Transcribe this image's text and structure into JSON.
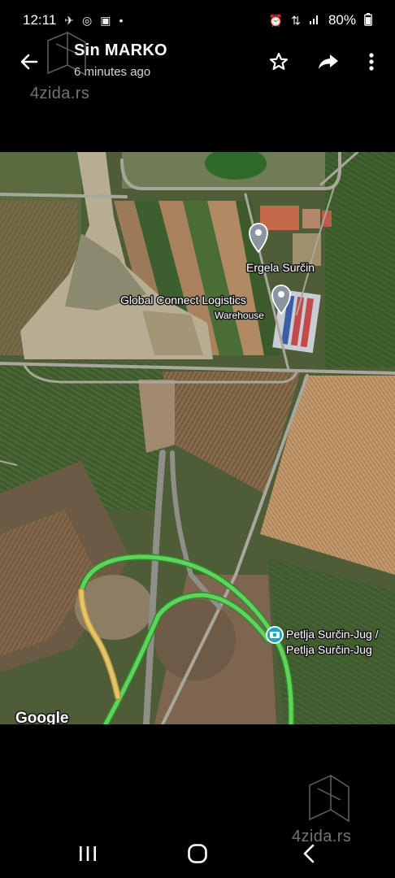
{
  "status_bar": {
    "time": "12:11",
    "battery": "80%",
    "left_icons": [
      "signal-app-icon",
      "whatsapp-icon",
      "gallery-icon",
      "dot-icon"
    ],
    "right_icons": [
      "alarm-icon",
      "data-icon",
      "cell-signal-icon",
      "battery-icon"
    ]
  },
  "header": {
    "sender": "Sin MARKO",
    "time_ago": "6 minutes ago",
    "actions": [
      "back-arrow-icon",
      "star-icon",
      "share-icon",
      "more-vert-icon"
    ]
  },
  "watermark": {
    "text": "4zida.rs"
  },
  "map": {
    "labels": {
      "place1": "Ergela Surčin",
      "place2_name": "Global Connect Logistics",
      "place2_type": "Warehouse",
      "place3_line1": "Petlja Surčin-Jug /",
      "place3_line2": "Petlja Surčin-Jug",
      "logo": "Google"
    },
    "colors": {
      "traffic_green": "#5fd35a",
      "traffic_yellow": "#e2c46a",
      "pin_gray": "#8b95a1",
      "pin_teal": "#19a7c0"
    }
  },
  "nav_bar": {
    "buttons": [
      "recents-icon",
      "home-icon",
      "back-icon"
    ]
  }
}
